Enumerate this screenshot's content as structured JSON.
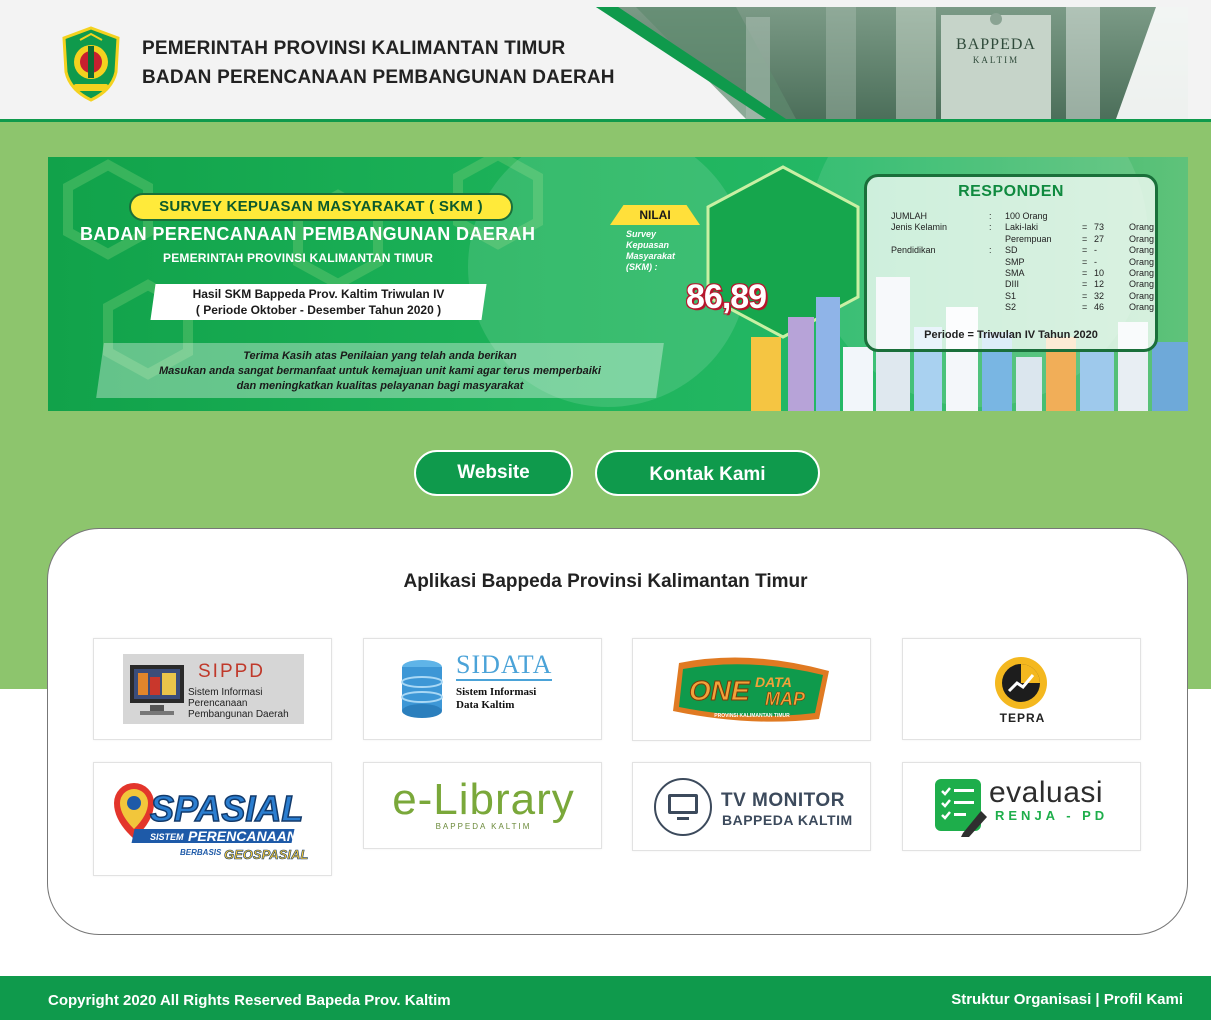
{
  "header": {
    "title_line1": "PEMERINTAH PROVINSI KALIMANTAN TIMUR",
    "title_line2": "BADAN PERENCANAAN PEMBANGUNAN DAERAH",
    "building_sign": "BAPPEDA",
    "building_sign_sub": "KALTIM",
    "colors": {
      "accent": "#0f9a4c",
      "band": "#8dc56d"
    }
  },
  "banner": {
    "skm_pill": "SURVEY KEPUASAN MASYARAKAT ( SKM )",
    "title": "BADAN PERENCANAAN PEMBANGUNAN DAERAH",
    "subtitle": "PEMERINTAH PROVINSI KALIMANTAN TIMUR",
    "hasil_line1": "Hasil SKM Bappeda Prov. Kaltim Triwulan IV",
    "hasil_line2": "( Periode Oktober - Desember Tahun 2020 )",
    "thanks_line1": "Terima Kasih atas Penilaian yang telah anda berikan",
    "thanks_line2": "Masukan anda sangat bermanfaat untuk kemajuan unit kami agar terus memperbaiki",
    "thanks_line3": "dan meningkatkan kualitas pelayanan bagi masyarakat",
    "nilai_badge": "NILAI",
    "nilai_label": "Survey Kepuasan Masyarakat (SKM) :",
    "nilai_value": "86,89",
    "responden": {
      "title": "RESPONDEN",
      "rows": [
        {
          "label": "JUMLAH",
          "sep": ":",
          "cat": "100 Orang",
          "eq": "",
          "val": "",
          "unit": ""
        },
        {
          "label": "Jenis Kelamin",
          "sep": ":",
          "cat": "Laki-laki",
          "eq": "=",
          "val": "73",
          "unit": "Orang"
        },
        {
          "label": "",
          "sep": "",
          "cat": "Perempuan",
          "eq": "=",
          "val": "27",
          "unit": "Orang"
        },
        {
          "label": "Pendidikan",
          "sep": ":",
          "cat": "SD",
          "eq": "=",
          "val": "-",
          "unit": "Orang"
        },
        {
          "label": "",
          "sep": "",
          "cat": "SMP",
          "eq": "=",
          "val": "-",
          "unit": "Orang"
        },
        {
          "label": "",
          "sep": "",
          "cat": "SMA",
          "eq": "=",
          "val": "10",
          "unit": "Orang"
        },
        {
          "label": "",
          "sep": "",
          "cat": "DIII",
          "eq": "=",
          "val": "12",
          "unit": "Orang"
        },
        {
          "label": "",
          "sep": "",
          "cat": "S1",
          "eq": "=",
          "val": "32",
          "unit": "Orang"
        },
        {
          "label": "",
          "sep": "",
          "cat": "S2",
          "eq": "=",
          "val": "46",
          "unit": "Orang"
        }
      ],
      "periode": "Periode = Triwulan IV Tahun 2020"
    }
  },
  "buttons": {
    "website": "Website",
    "kontak": "Kontak Kami"
  },
  "apps": {
    "title": "Aplikasi Bappeda Provinsi Kalimantan Timur",
    "items": [
      {
        "name": "SIPPD",
        "desc_l1": "Sistem Informasi",
        "desc_l2": "Perencanaan",
        "desc_l3": "Pembangunan Daerah"
      },
      {
        "name": "SIDATA",
        "desc_l1": "Sistem Informasi",
        "desc_l2": "Data Kaltim"
      },
      {
        "name_one": "ONE",
        "name_data": "DATA",
        "name_map": "MAP",
        "tag": "PROVINSI KALIMANTAN TIMUR"
      },
      {
        "name": "TEPRA"
      },
      {
        "name": "SPASIAL",
        "tag1": "SISTEM",
        "tag2": "PERENCANAAN",
        "tag3": "BERBASIS",
        "tag4": "GEOSPASIAL"
      },
      {
        "name": "e-Library",
        "tag": "BAPPEDA KALTIM"
      },
      {
        "name": "TV MONITOR",
        "tag": "BAPPEDA KALTIM"
      },
      {
        "name": "evaluasi",
        "tag": "RENJA - PD"
      }
    ]
  },
  "footer": {
    "copyright": "Copyright 2020 All Rights Reserved Bapeda Prov. Kaltim",
    "link1": "Struktur Organisasi",
    "separator": " | ",
    "link2": "Profil Kami"
  }
}
